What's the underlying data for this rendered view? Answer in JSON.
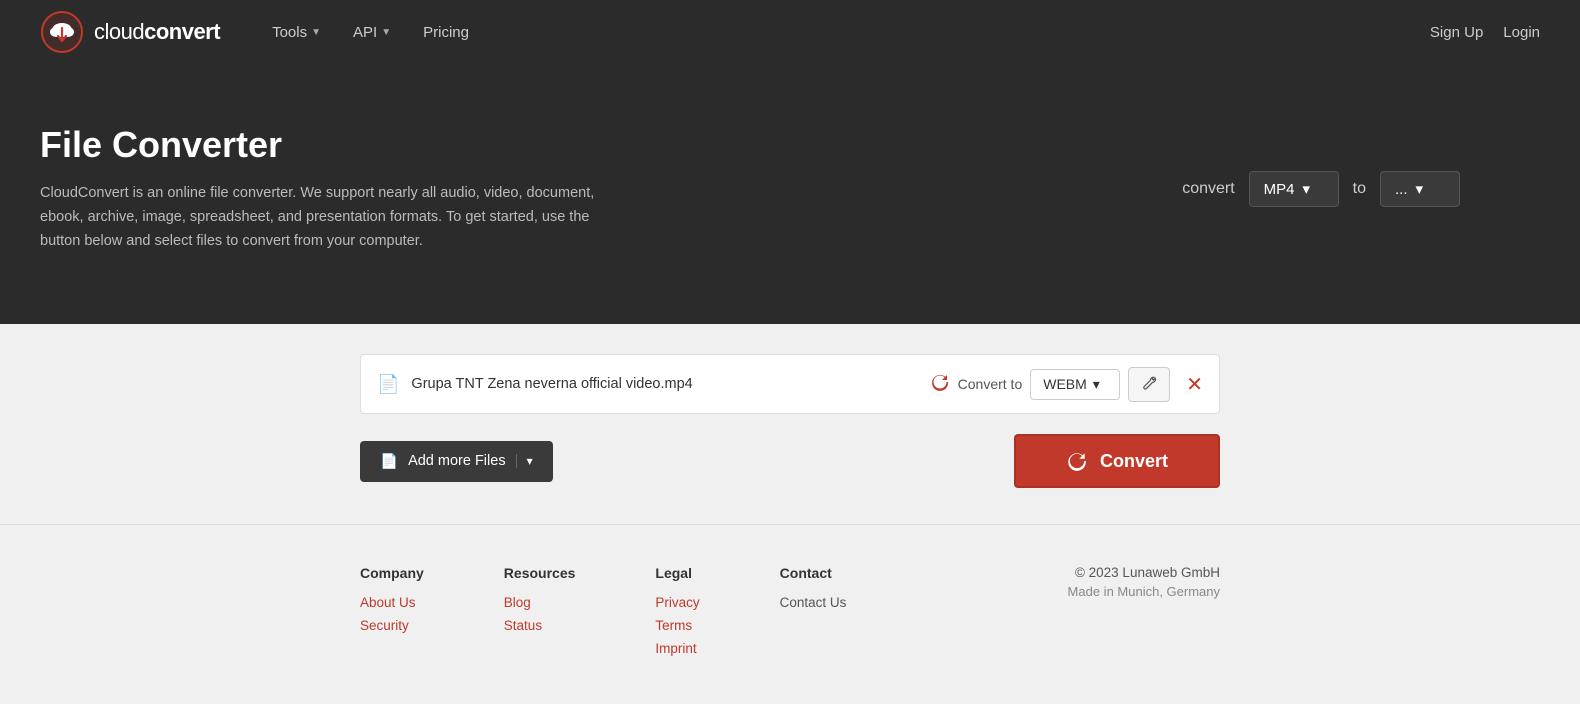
{
  "header": {
    "logo_text_light": "cloud",
    "logo_text_bold": "convert",
    "nav": [
      {
        "label": "Tools",
        "has_dropdown": true
      },
      {
        "label": "API",
        "has_dropdown": true
      },
      {
        "label": "Pricing",
        "has_dropdown": false
      }
    ],
    "auth": {
      "signup": "Sign Up",
      "login": "Login"
    }
  },
  "hero": {
    "title": "File Converter",
    "description": "CloudConvert is an online file converter. We support nearly all audio, video, document, ebook, archive, image, spreadsheet, and presentation formats. To get started, use the button below and select files to convert from your computer.",
    "convert_label": "convert",
    "format_from": "MP4",
    "to_label": "to",
    "format_to": "..."
  },
  "main": {
    "file": {
      "name": "Grupa TNT Zena neverna official video.mp4",
      "convert_to_label": "Convert to",
      "format": "WEBM"
    },
    "add_files_label": "Add more Files",
    "convert_label": "Convert"
  },
  "footer": {
    "columns": [
      {
        "heading": "Company",
        "links": [
          {
            "label": "About Us",
            "style": "red"
          },
          {
            "label": "Security",
            "style": "red"
          }
        ]
      },
      {
        "heading": "Resources",
        "links": [
          {
            "label": "Blog",
            "style": "red"
          },
          {
            "label": "Status",
            "style": "red"
          }
        ]
      },
      {
        "heading": "Legal",
        "links": [
          {
            "label": "Privacy",
            "style": "red"
          },
          {
            "label": "Terms",
            "style": "red"
          },
          {
            "label": "Imprint",
            "style": "red"
          }
        ]
      },
      {
        "heading": "Contact",
        "links": [
          {
            "label": "Contact Us",
            "style": "dark"
          }
        ]
      }
    ],
    "copyright": "© 2023 Lunaweb GmbH",
    "location": "Made in Munich, Germany"
  }
}
